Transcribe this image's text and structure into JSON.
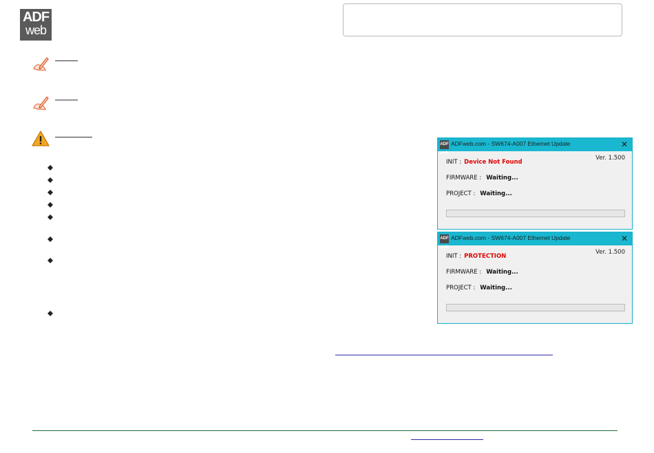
{
  "logo": {
    "line1": "ADF",
    "line2": "web"
  },
  "icons": {
    "note": "pencil-note-icon",
    "warning": "warning-triangle-icon",
    "bullet": "diamond-bullet-icon"
  },
  "colors": {
    "titlebar": "#19b7d0",
    "error_text": "#e00000",
    "footer_rule": "#1f6b3a",
    "link": "#2a2aa8"
  },
  "dialogs": [
    {
      "title": "ADFweb.com - SW674-A007 Ethernet Update",
      "app_icon": "ADF web",
      "close": "✕",
      "version": "Ver. 1.500",
      "init_label": "INIT :",
      "init_value": "Device Not Found",
      "firmware_label": "FIRMWARE :",
      "firmware_value": "Waiting...",
      "project_label": "PROJECT :",
      "project_value": "Waiting...",
      "progress": 0
    },
    {
      "title": "ADFweb.com - SW674-A007 Ethernet Update",
      "app_icon": "ADF web",
      "close": "✕",
      "version": "Ver. 1.500",
      "init_label": "INIT :",
      "init_value": "PROTECTION",
      "firmware_label": "FIRMWARE :",
      "firmware_value": "Waiting...",
      "project_label": "PROJECT :",
      "project_value": "Waiting...",
      "progress": 0
    }
  ]
}
